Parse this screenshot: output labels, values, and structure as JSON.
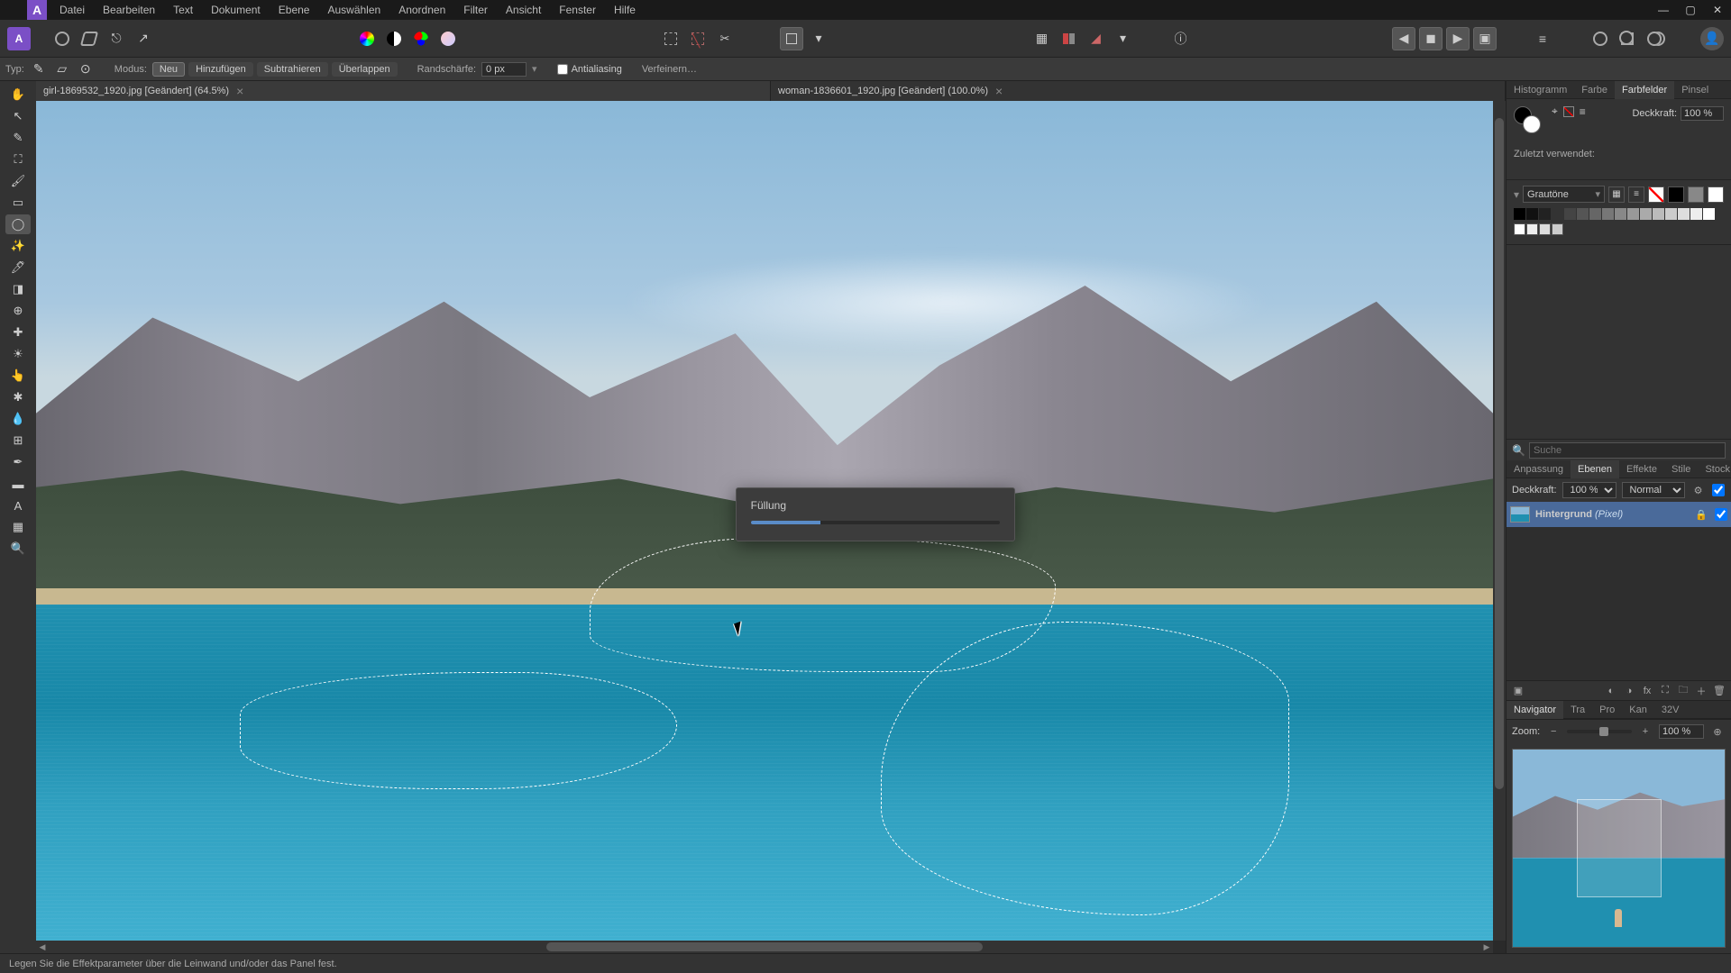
{
  "menu": [
    "Datei",
    "Bearbeiten",
    "Text",
    "Dokument",
    "Ebene",
    "Auswählen",
    "Anordnen",
    "Filter",
    "Ansicht",
    "Fenster",
    "Hilfe"
  ],
  "context": {
    "typ_label": "Typ:",
    "modus_label": "Modus:",
    "modes": [
      "Neu",
      "Hinzufügen",
      "Subtrahieren",
      "Überlappen"
    ],
    "mode_selected": "Neu",
    "feather_label": "Randschärfe:",
    "feather_value": "0 px",
    "antialias_label": "Antialiasing",
    "antialias_checked": false,
    "refine_label": "Verfeinern…"
  },
  "tabs": [
    {
      "title": "girl-1869532_1920.jpg [Geändert] (64.5%)",
      "active": true
    },
    {
      "title": "woman-1836601_1920.jpg [Geändert] (100.0%)",
      "active": false
    }
  ],
  "dialog": {
    "title": "Füllung"
  },
  "right": {
    "top_tabs": [
      "Histogramm",
      "Farbe",
      "Farbfelder",
      "Pinsel"
    ],
    "top_active": "Farbfelder",
    "opacity_label": "Deckkraft:",
    "opacity_value": "100 %",
    "recent_label": "Zuletzt verwendet:",
    "preset_label": "Grautöne",
    "search_placeholder": "Suche",
    "mid_tabs": [
      "Anpassung",
      "Ebenen",
      "Effekte",
      "Stile",
      "Stock"
    ],
    "mid_active": "Ebenen",
    "layer_opacity_label": "Deckkraft:",
    "layer_opacity_value": "100 %",
    "blend_value": "Normal",
    "layer_name": "Hintergrund",
    "layer_tag": "(Pixel)",
    "nav_tabs": [
      "Navigator",
      "Tra",
      "Pro",
      "Kan",
      "32V"
    ],
    "nav_active": "Navigator",
    "zoom_label": "Zoom:",
    "zoom_value": "100 %"
  },
  "status_text": "Legen Sie die Effektparameter über die Leinwand und/oder das Panel fest."
}
